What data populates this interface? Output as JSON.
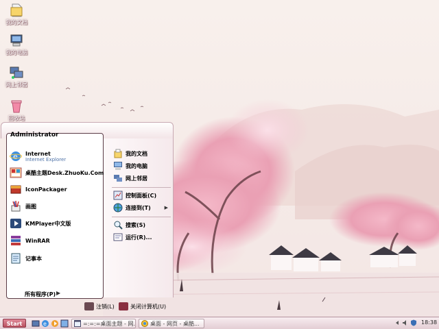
{
  "desktop": {
    "icons": [
      {
        "label": "我的文档",
        "icon": "my-documents-icon"
      },
      {
        "label": "我的电脑",
        "icon": "my-computer-icon"
      },
      {
        "label": "网上邻居",
        "icon": "network-places-icon"
      },
      {
        "label": "回收站",
        "icon": "recycle-bin-icon"
      }
    ]
  },
  "start_menu": {
    "user_name": "Administrator",
    "pinned": [
      {
        "title": "Internet",
        "subtitle": "Internet Explorer",
        "icon": "internet-explorer-icon"
      },
      {
        "title": "桌酷主题Desk.ZhuoKu.Com",
        "icon": "zhuoku-theme-icon"
      },
      {
        "title": "IconPackager",
        "icon": "iconpackager-icon"
      },
      {
        "title": "画图",
        "icon": "paint-icon"
      },
      {
        "title": "KMPlayer中文版",
        "icon": "kmplayer-icon"
      },
      {
        "title": "WinRAR",
        "icon": "winrar-icon"
      },
      {
        "title": "记事本",
        "icon": "notepad-icon"
      }
    ],
    "all_programs": "所有程序(P)",
    "right": [
      {
        "label": "我的文档",
        "icon": "my-documents-icon"
      },
      {
        "label": "我的电脑",
        "icon": "my-computer-icon"
      },
      {
        "label": "网上邻居",
        "icon": "network-places-icon"
      },
      {
        "label": "控制面板(C)",
        "icon": "control-panel-icon"
      },
      {
        "label": "连接到(T)",
        "icon": "connect-to-icon"
      },
      {
        "label": "搜索(S)",
        "icon": "search-icon"
      },
      {
        "label": "运行(R)...",
        "icon": "run-icon"
      }
    ],
    "logoff": "注销(L)",
    "shutdown": "关闭计算机(U)"
  },
  "taskbar": {
    "start_label": "Start",
    "tasks": [
      {
        "label": "=:=:=桌面主题 - 网...",
        "icon": "window-icon"
      },
      {
        "label": "桌面 - 网页 - 桌酷...",
        "icon": "browser-icon"
      }
    ],
    "clock": "18:38"
  },
  "colors": {
    "accent": "#c0506a",
    "start_button": "#b9505f",
    "taskbar": "#efdde2"
  }
}
